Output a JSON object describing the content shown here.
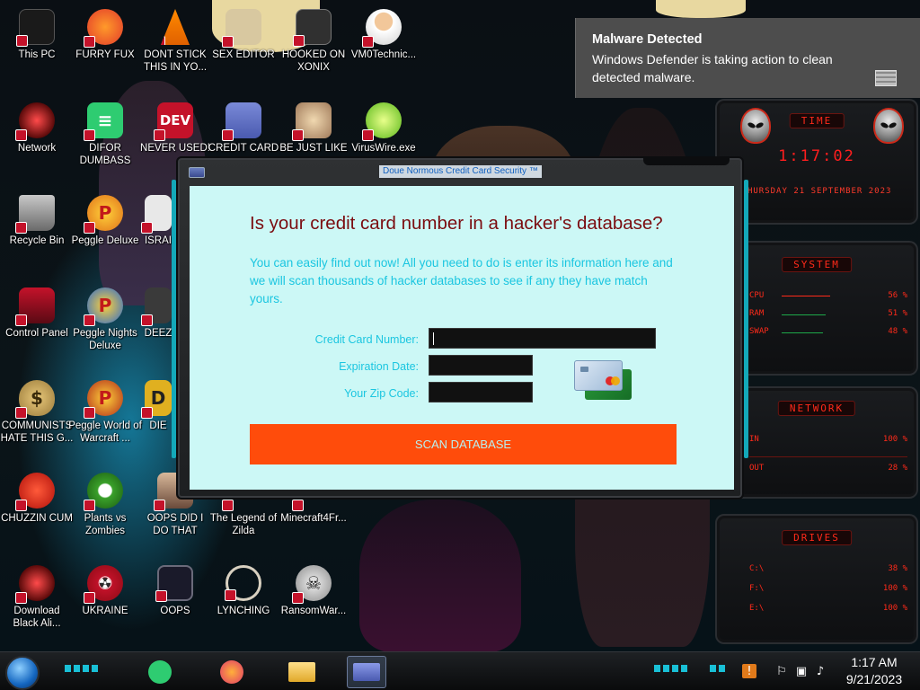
{
  "desktop": {
    "icons": [
      {
        "label": "This PC"
      },
      {
        "label": "FURRY FUX"
      },
      {
        "label": "DONT STICK THIS IN YO..."
      },
      {
        "label": "SEX EDITOR"
      },
      {
        "label": "HOOKED ON XONIX"
      },
      {
        "label": "VM0Technic..."
      },
      {
        "label": "Network"
      },
      {
        "label": "DIFOR DUMBASS"
      },
      {
        "label": "NEVER USED!"
      },
      {
        "label": "CREDIT CARD"
      },
      {
        "label": "BE JUST LIKE"
      },
      {
        "label": "VirusWire.exe"
      },
      {
        "label": "Recycle Bin"
      },
      {
        "label": "Peggle Deluxe"
      },
      {
        "label": "ISRAI"
      },
      {
        "label": "Control Panel"
      },
      {
        "label": "Peggle Nights Deluxe"
      },
      {
        "label": "DEEZ"
      },
      {
        "label": "COMMUNISTS HATE THIS G..."
      },
      {
        "label": "Peggle World of Warcraft ..."
      },
      {
        "label": "DIE"
      },
      {
        "label": "CHUZZIN CUM"
      },
      {
        "label": "Plants vs Zombies"
      },
      {
        "label": "OOPS DID I DO THAT"
      },
      {
        "label": "The Legend of Zilda"
      },
      {
        "label": "Minecraft4Fr..."
      },
      {
        "label": "Download Black Ali..."
      },
      {
        "label": "UKRAINE"
      },
      {
        "label": "OOPS"
      },
      {
        "label": "LYNCHING"
      },
      {
        "label": "RansomWar..."
      }
    ]
  },
  "dialog": {
    "title": "Doue Normous Credit Card Security ™",
    "headline": "Is your credit card number in a hacker's database?",
    "intro": "You can easily find out now! All you need to do is enter its information here and we will scan thousands of hacker databases to see if any they have match yours.",
    "fields": {
      "card_number_label": "Credit Card Number:",
      "card_number_value": "",
      "expiration_label": "Expiration Date:",
      "expiration_value": "",
      "zip_label": "Your Zip Code:",
      "zip_value": ""
    },
    "scan_button": "SCAN DATABASE"
  },
  "notification": {
    "title": "Malware Detected",
    "body": "Windows Defender is taking action to clean detected malware."
  },
  "gadgets": {
    "time_title": "TIME",
    "time": "1:17:02",
    "date": "THURSDAY 21 SEPTEMBER 2023",
    "system_title": "SYSTEM",
    "cpu_label": "CPU",
    "cpu_value": "56 %",
    "cpu_level": 0.56,
    "ram_label": "RAM",
    "ram_value": "51 %",
    "ram_level": 0.51,
    "swap_label": "SWAP",
    "swap_value": "48 %",
    "swap_level": 0.48,
    "network_title": "NETWORK",
    "in_label": "IN",
    "in_value": "100 %",
    "out_label": "OUT",
    "out_value": "28 %",
    "drives_title": "DRIVES",
    "drives": [
      {
        "label": "C:\\",
        "value": "38 %"
      },
      {
        "label": "F:\\",
        "value": "100 %"
      },
      {
        "label": "E:\\",
        "value": "100 %"
      }
    ]
  },
  "taskbar": {
    "time": "1:17 AM",
    "date": "9/21/2023"
  },
  "colors": {
    "dialog_bg": "#ccf8f6",
    "headline": "#7b0c10",
    "accent_text": "#1bc6e0",
    "scan_button": "#ff4c0b",
    "gadget_red": "#ff1e1e"
  }
}
